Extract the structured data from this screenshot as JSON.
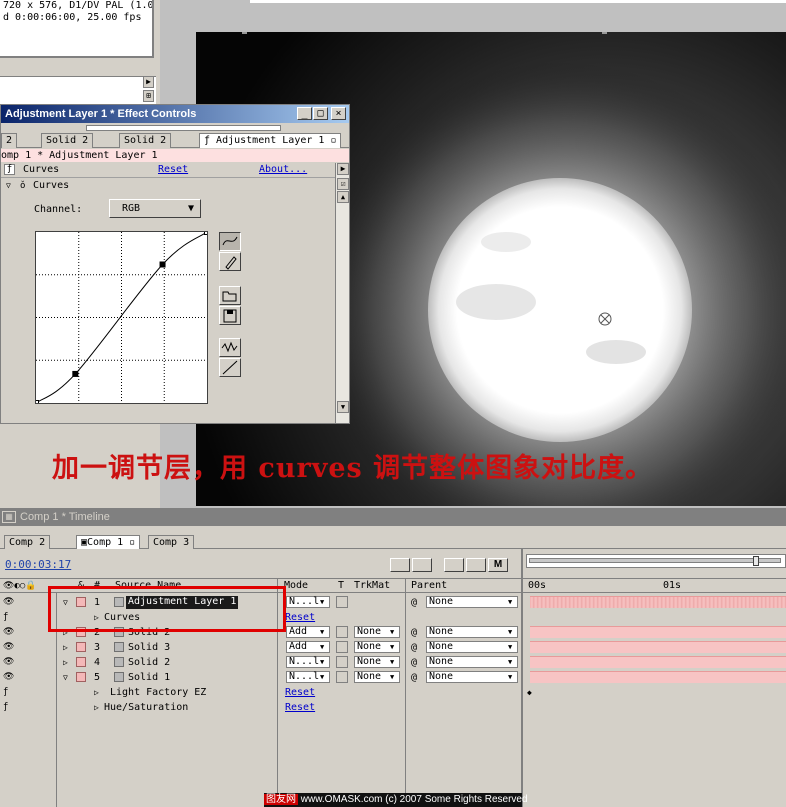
{
  "project": {
    "info_line1": "720 x 576, D1/DV PAL (1.0",
    "info_line2": "d 0:00:06:00, 25.00 fps"
  },
  "effect_controls": {
    "title": "Adjustment Layer 1 * Effect Controls",
    "tabs": [
      "2",
      "Solid 2",
      "Solid 2",
      "Adjustment Layer 1"
    ],
    "breadcrumb": "omp 1 * Adjustment Layer 1",
    "effect_name": "Curves",
    "reset_label": "Reset",
    "about_label": "About...",
    "curves_label": "Curves",
    "channel_label": "Channel:",
    "channel_value": "RGB",
    "curve_points": [
      [
        0,
        0
      ],
      [
        0.23,
        0.17
      ],
      [
        0.74,
        0.81
      ],
      [
        1,
        1
      ]
    ]
  },
  "caption": "加一调节层，用 curves 调节整体图象对比度。",
  "timeline": {
    "title": "Comp 1 * Timeline",
    "tabs": [
      "Comp 2",
      "Comp 1",
      "Comp 3"
    ],
    "timecode": "0:00:03:17",
    "ruler_start": "00s",
    "ruler_mid": "01s",
    "columns": {
      "source_name": "Source Name",
      "mode": "Mode",
      "t": "T",
      "trkmat": "TrkMat",
      "parent": "Parent"
    },
    "layers": [
      {
        "num": "1",
        "name": "Adjustment Layer 1",
        "mode": "N...l",
        "trkmat": "",
        "parent": "None",
        "expanded": true
      },
      {
        "num": "2",
        "name": "Solid 2",
        "mode": "Add",
        "trkmat": "None",
        "parent": "None",
        "expanded": false
      },
      {
        "num": "3",
        "name": "Solid 3",
        "mode": "Add",
        "trkmat": "None",
        "parent": "None",
        "expanded": false
      },
      {
        "num": "4",
        "name": "Solid 2",
        "mode": "N...l",
        "trkmat": "None",
        "parent": "None",
        "expanded": false
      },
      {
        "num": "5",
        "name": "Solid 1",
        "mode": "N...l",
        "trkmat": "None",
        "parent": "None",
        "expanded": true
      }
    ],
    "effects": {
      "curves": {
        "name": "Curves",
        "reset": "Reset"
      },
      "light_factory": {
        "name": "Light Factory EZ",
        "reset": "Reset"
      },
      "hue_sat": {
        "name": "Hue/Saturation",
        "reset": "Reset"
      }
    }
  },
  "footer": {
    "brand": "图友网",
    "text": " www.OMASK.com (c) 2007 Some Rights Reserved"
  },
  "colors": {
    "accent_red": "#cc1111",
    "layer_bar": "#f7c4c4",
    "title_blue": "#0a246a"
  }
}
